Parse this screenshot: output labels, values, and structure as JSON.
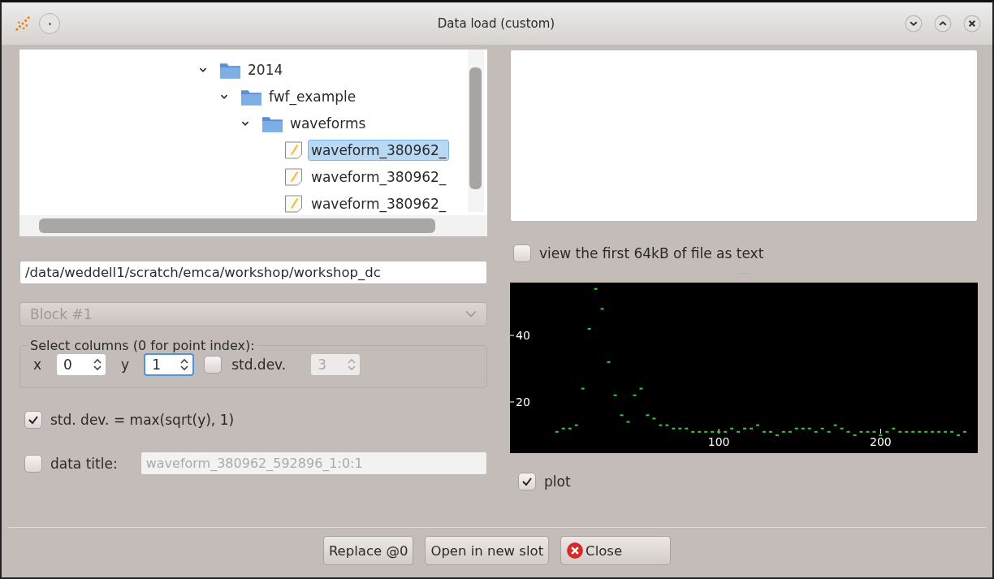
{
  "window": {
    "title": "Data load (custom)"
  },
  "tree": [
    {
      "label": "2014",
      "kind": "folder",
      "expanded": true,
      "selected": false,
      "children": [
        {
          "label": "fwf_example",
          "kind": "folder",
          "expanded": true,
          "selected": false,
          "children": [
            {
              "label": "waveforms",
              "kind": "folder",
              "expanded": true,
              "selected": false,
              "children": [
                {
                  "label": "waveform_380962_",
                  "kind": "file",
                  "selected": true
                },
                {
                  "label": "waveform_380962_",
                  "kind": "file",
                  "selected": false
                },
                {
                  "label": "waveform_380962_",
                  "kind": "file",
                  "selected": false
                }
              ]
            }
          ]
        }
      ]
    }
  ],
  "path": {
    "value": "/data/weddell1/scratch/emca/workshop/workshop_dc"
  },
  "block": {
    "value": "Block #1",
    "disabled": true
  },
  "columns": {
    "title": "Select columns (0 for point index):",
    "x": {
      "label": "x",
      "value": "0",
      "focused": false
    },
    "y": {
      "label": "y",
      "value": "1",
      "focused": true
    },
    "std_dev": {
      "label": "std.dev.",
      "checked": false
    },
    "std_dev_col": {
      "value": "3",
      "focused": false,
      "disabled": true
    }
  },
  "sqrt_option": {
    "label": "std. dev. = max(sqrt(y), 1)",
    "checked": true
  },
  "data_title": {
    "label": "data title:",
    "checked": false,
    "value": "waveform_380962_592896_1:0:1"
  },
  "view_text": {
    "label": "view the first 64kB of file as text",
    "checked": false
  },
  "chart": {
    "chart_data": {
      "type": "scatter",
      "xlim": [
        -29,
        260
      ],
      "ylim": [
        4.6,
        55.9
      ],
      "xticks": [
        100,
        200
      ],
      "yticks": [
        20,
        40
      ],
      "x": [
        0,
        4,
        8,
        12,
        16,
        20,
        24,
        28,
        32,
        36,
        40,
        44,
        48,
        52,
        56,
        60,
        64,
        68,
        72,
        76,
        80,
        84,
        88,
        92,
        96,
        100,
        104,
        108,
        112,
        116,
        120,
        124,
        128,
        132,
        136,
        140,
        144,
        148,
        152,
        156,
        160,
        164,
        168,
        172,
        176,
        180,
        184,
        188,
        192,
        196,
        200,
        204,
        208,
        212,
        216,
        220,
        224,
        228,
        232,
        236,
        240,
        244,
        248,
        252
      ],
      "series": [
        {
          "color": "#33cc33",
          "values": [
            11,
            12,
            12,
            13,
            24,
            42,
            54,
            48,
            32,
            22,
            16,
            14,
            22,
            24,
            16,
            15,
            13,
            13,
            12,
            12,
            12,
            11,
            11,
            11,
            11,
            11,
            11,
            12,
            11,
            12,
            12,
            13,
            11,
            11,
            10,
            11,
            11,
            12,
            12,
            12,
            11,
            12,
            11,
            13,
            12,
            11,
            10,
            11,
            11,
            11,
            10,
            11,
            12,
            11,
            11,
            11,
            11,
            11,
            11,
            11,
            11,
            11,
            10,
            11
          ]
        }
      ]
    }
  },
  "plot": {
    "label": "plot",
    "checked": true
  },
  "buttons": [
    {
      "label": "Replace @0",
      "kind": "plain"
    },
    {
      "label": "Open in new slot",
      "kind": "plain"
    },
    {
      "label": "Close",
      "kind": "close"
    }
  ]
}
